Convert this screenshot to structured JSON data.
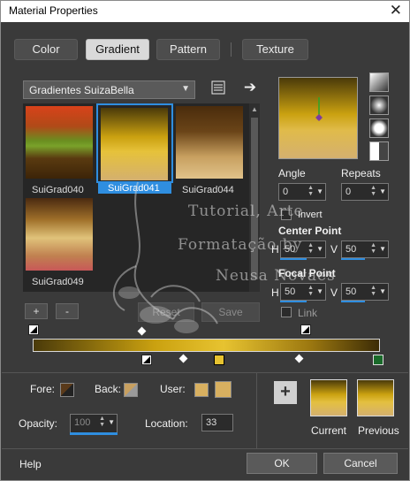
{
  "window": {
    "title": "Material Properties",
    "close_glyph": "✕"
  },
  "tabs": [
    {
      "label": "Color"
    },
    {
      "label": "Gradient"
    },
    {
      "label": "Pattern"
    },
    {
      "label": "Texture"
    }
  ],
  "gradient_set": {
    "selected": "Gradientes SuizaBella"
  },
  "gallery": {
    "items": [
      {
        "label": "SuiGrad040"
      },
      {
        "label": "SuiGrad041"
      },
      {
        "label": "SuiGrad044"
      },
      {
        "label": "SuiGrad049"
      }
    ]
  },
  "angle": {
    "label": "Angle",
    "value": "0"
  },
  "repeats": {
    "label": "Repeats",
    "value": "0"
  },
  "invert": {
    "label": "Invert"
  },
  "center_point": {
    "label": "Center Point",
    "h_label": "H",
    "h_value": "50",
    "v_label": "V",
    "v_value": "50"
  },
  "focal_point": {
    "label": "Focal Point",
    "h_label": "H",
    "h_value": "50",
    "v_label": "V",
    "v_value": "50"
  },
  "link": {
    "label": "Link"
  },
  "buttons": {
    "add": "+",
    "remove": "-",
    "reset": "Reset",
    "save": "Save",
    "help": "Help",
    "ok": "OK",
    "cancel": "Cancel",
    "add_swatch": "+"
  },
  "stops": {
    "fore_label": "Fore:",
    "back_label": "Back:",
    "user_label": "User:",
    "opacity_label": "Opacity:",
    "opacity_value": "100",
    "location_label": "Location:",
    "location_value": "33"
  },
  "result": {
    "current_label": "Current",
    "previous_label": "Previous"
  },
  "watermark": {
    "line1": "Tutorial, Arte",
    "line2": "Formatação by",
    "line3": "Neusa Novaes"
  },
  "colors": {
    "accent": "#2f8ee0",
    "dialog_bg": "#3a3a3a"
  }
}
